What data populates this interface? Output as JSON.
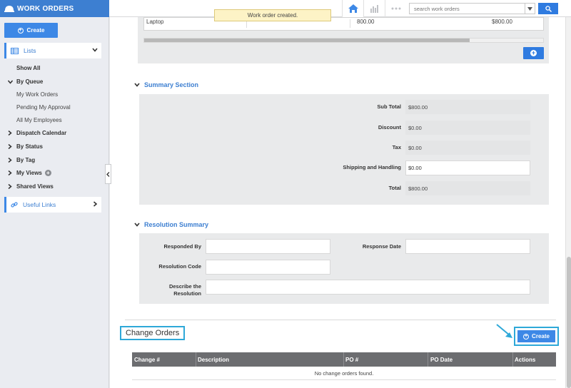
{
  "app": {
    "title": "WORK ORDERS"
  },
  "toast": {
    "message": "Work order created."
  },
  "topbar": {
    "search_placeholder": "search work orders",
    "icons": [
      "home-icon",
      "chart-icon",
      "more-icon",
      "search-icon"
    ]
  },
  "sidebar": {
    "create_label": "Create",
    "lists_label": "Lists",
    "useful_links_label": "Useful Links",
    "items": [
      {
        "label": "Show All"
      },
      {
        "label": "By Queue"
      },
      {
        "label": "My Work Orders"
      },
      {
        "label": "Pending My Approval"
      },
      {
        "label": "All My Employees"
      },
      {
        "label": "Dispatch Calendar"
      },
      {
        "label": "By Status"
      },
      {
        "label": "By Tag"
      },
      {
        "label": "My Views"
      },
      {
        "label": "Shared Views"
      }
    ]
  },
  "items_table": {
    "row": {
      "name": "Laptop",
      "price": "800.00",
      "total": "$800.00"
    }
  },
  "summary": {
    "title": "Summary Section",
    "sub_total_label": "Sub Total",
    "sub_total": "$800.00",
    "discount_label": "Discount",
    "discount": "$0.00",
    "tax_label": "Tax",
    "tax": "$0.00",
    "shipping_label": "Shipping and Handling",
    "shipping": "$0.00",
    "total_label": "Total",
    "total": "$800.00"
  },
  "resolution": {
    "title": "Resolution Summary",
    "responded_by_label": "Responded By",
    "response_date_label": "Response Date",
    "resolution_code_label": "Resolution Code",
    "describe_label_1": "Describe the",
    "describe_label_2": "Resolution"
  },
  "change_orders": {
    "title": "Change Orders",
    "create_label": "Create",
    "columns": [
      "Change #",
      "Description",
      "PO #",
      "PO Date",
      "Actions"
    ],
    "empty_message": "No change orders found."
  },
  "colors": {
    "brand": "#3d7fd1",
    "button": "#3d88e6",
    "highlight": "#2ea8d8"
  }
}
